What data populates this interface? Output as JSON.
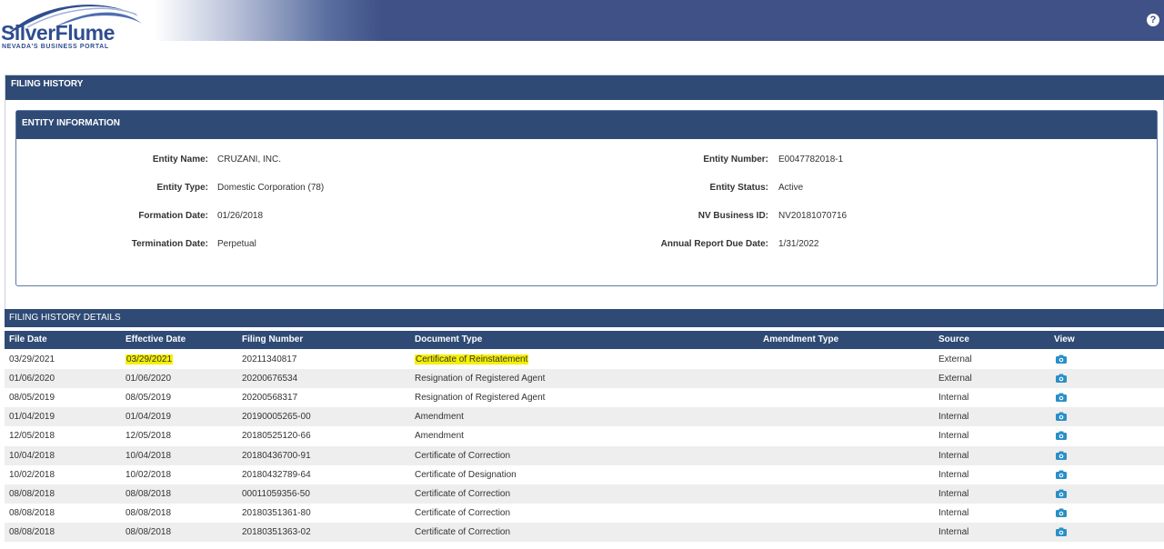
{
  "header": {
    "logo_text": "SilverFlume",
    "logo_subtitle": "NEVADA'S BUSINESS PORTAL",
    "help_glyph": "?",
    "brand_color": "#3f5187"
  },
  "filing_history": {
    "title": "FILING HISTORY"
  },
  "entity_information": {
    "title": "ENTITY INFORMATION",
    "left_fields": [
      {
        "label": "Entity Name:",
        "value": "CRUZANI, INC."
      },
      {
        "label": "Entity Type:",
        "value": "Domestic Corporation (78)"
      },
      {
        "label": "Formation Date:",
        "value": "01/26/2018"
      },
      {
        "label": "Termination Date:",
        "value": "Perpetual"
      }
    ],
    "right_fields": [
      {
        "label": "Entity Number:",
        "value": "E0047782018-1"
      },
      {
        "label": "Entity Status:",
        "value": "Active"
      },
      {
        "label": "NV Business ID:",
        "value": "NV20181070716"
      },
      {
        "label": "Annual Report Due Date:",
        "value": "1/31/2022"
      }
    ]
  },
  "details": {
    "title": "FILING HISTORY DETAILS",
    "columns": [
      "File Date",
      "Effective Date",
      "Filing Number",
      "Document Type",
      "Amendment Type",
      "Source",
      "View"
    ],
    "view_icon": "camera-icon",
    "highlight_color": "#f5f000",
    "rows": [
      {
        "file_date": "03/29/2021",
        "effective_date": "03/29/2021",
        "filing_number": "20211340817",
        "document_type": "Certificate of Reinstatement",
        "amendment_type": "",
        "source": "External"
      },
      {
        "file_date": "01/06/2020",
        "effective_date": "01/06/2020",
        "filing_number": "20200676534",
        "document_type": "Resignation of Registered Agent",
        "amendment_type": "",
        "source": "External"
      },
      {
        "file_date": "08/05/2019",
        "effective_date": "08/05/2019",
        "filing_number": "20200568317",
        "document_type": "Resignation of Registered Agent",
        "amendment_type": "",
        "source": "Internal"
      },
      {
        "file_date": "01/04/2019",
        "effective_date": "01/04/2019",
        "filing_number": "20190005265-00",
        "document_type": "Amendment",
        "amendment_type": "",
        "source": "Internal"
      },
      {
        "file_date": "12/05/2018",
        "effective_date": "12/05/2018",
        "filing_number": "20180525120-66",
        "document_type": "Amendment",
        "amendment_type": "",
        "source": "Internal"
      },
      {
        "file_date": "10/04/2018",
        "effective_date": "10/04/2018",
        "filing_number": "20180436700-91",
        "document_type": "Certificate of Correction",
        "amendment_type": "",
        "source": "Internal"
      },
      {
        "file_date": "10/02/2018",
        "effective_date": "10/02/2018",
        "filing_number": "20180432789-64",
        "document_type": "Certificate of Designation",
        "amendment_type": "",
        "source": "Internal"
      },
      {
        "file_date": "08/08/2018",
        "effective_date": "08/08/2018",
        "filing_number": "00011059356-50",
        "document_type": "Certificate of Correction",
        "amendment_type": "",
        "source": "Internal"
      },
      {
        "file_date": "08/08/2018",
        "effective_date": "08/08/2018",
        "filing_number": "20180351361-80",
        "document_type": "Certificate of Correction",
        "amendment_type": "",
        "source": "Internal"
      },
      {
        "file_date": "08/08/2018",
        "effective_date": "08/08/2018",
        "filing_number": "20180351363-02",
        "document_type": "Certificate of Correction",
        "amendment_type": "",
        "source": "Internal"
      }
    ]
  }
}
